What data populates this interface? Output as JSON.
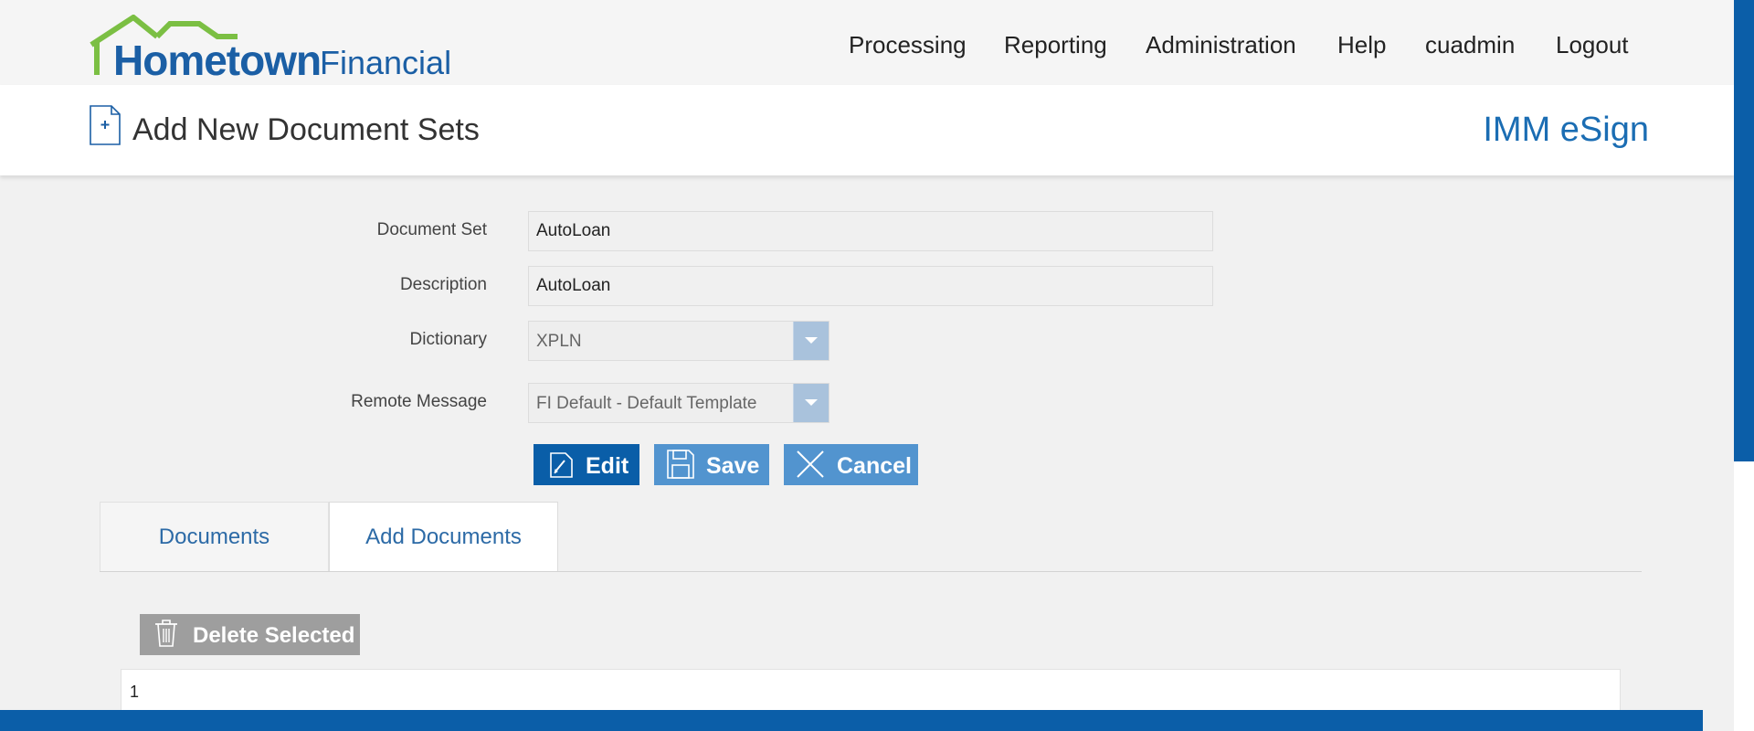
{
  "brand": {
    "name_primary": "Hometown",
    "name_secondary": "Financial",
    "roof_color": "#7bbf43",
    "brand_color": "#1b5fa5"
  },
  "nav": {
    "items": [
      {
        "label": "Processing"
      },
      {
        "label": "Reporting"
      },
      {
        "label": "Administration"
      },
      {
        "label": "Help"
      },
      {
        "label": "cuadmin"
      },
      {
        "label": "Logout"
      }
    ]
  },
  "page": {
    "title": "Add New Document Sets",
    "title_icon": "document-plus-icon",
    "product": "IMM eSign"
  },
  "form": {
    "document_set": {
      "label": "Document Set",
      "value": "AutoLoan"
    },
    "description": {
      "label": "Description",
      "value": "AutoLoan"
    },
    "dictionary": {
      "label": "Dictionary",
      "value": "XPLN"
    },
    "remote_message": {
      "label": "Remote Message",
      "value": "FI Default - Default Template"
    }
  },
  "actions": {
    "edit": {
      "label": "Edit",
      "icon": "pencil-document-icon"
    },
    "save": {
      "label": "Save",
      "icon": "floppy-disk-icon"
    },
    "cancel": {
      "label": "Cancel",
      "icon": "close-x-icon"
    }
  },
  "tabs": [
    {
      "label": "Documents"
    },
    {
      "label": "Add Documents",
      "active": true
    }
  ],
  "documents": {
    "delete_label": "Delete Selected",
    "delete_icon": "trash-can-icon",
    "rows": [
      {
        "cell": "1"
      }
    ]
  },
  "colors": {
    "accent": "#0a5ea8",
    "button_light": "#5294cf",
    "button_disabled": "#9e9e9e",
    "link": "#2c6aa6"
  }
}
